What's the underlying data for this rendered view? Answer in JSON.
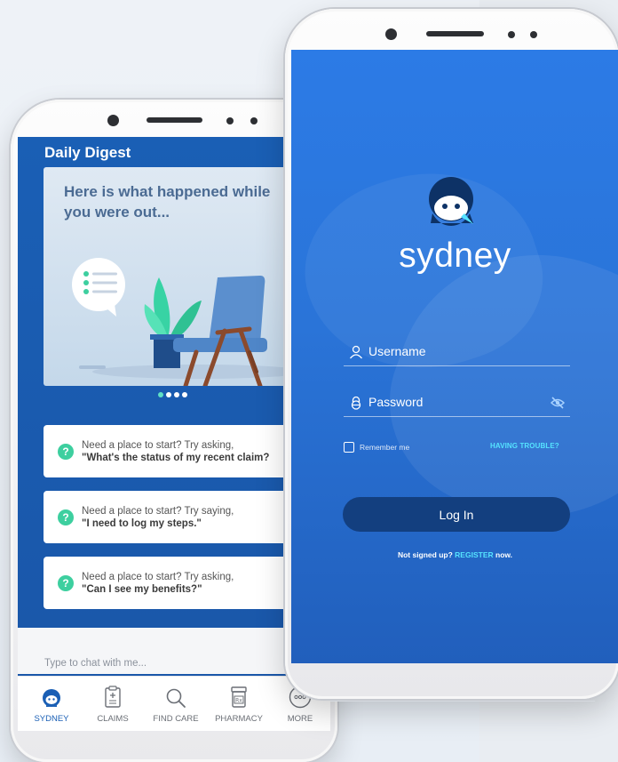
{
  "left_phone": {
    "digest_title": "Daily Digest",
    "hero_text": "Here is what happened while you were out...",
    "carousel_pages": 4,
    "carousel_active_index": 0,
    "prompts": [
      {
        "intro": "Need a place to start? Try asking,",
        "question": "\"What's the status of my recent claim?"
      },
      {
        "intro": "Need a place to start? Try saying,",
        "question": "\"I need to log my steps.\""
      },
      {
        "intro": "Need a place to start? Try asking,",
        "question": "\"Can I see my benefits?\""
      }
    ],
    "prompt_icon": "?",
    "chat_placeholder": "Type to chat with me...",
    "tabs": [
      {
        "label": "SYDNEY",
        "icon": "sydney-avatar-icon",
        "active": true
      },
      {
        "label": "CLAIMS",
        "icon": "clipboard-icon",
        "active": false
      },
      {
        "label": "FIND CARE",
        "icon": "search-icon",
        "active": false
      },
      {
        "label": "PHARMACY",
        "icon": "pill-bottle-icon",
        "active": false
      },
      {
        "label": "MORE",
        "icon": "more-icon",
        "active": false
      }
    ]
  },
  "right_phone": {
    "brand_name": "sydney",
    "username_label": "Username",
    "password_label": "Password",
    "remember_label": "Remember me",
    "trouble_link": "HAVING TROUBLE?",
    "login_button": "Log In",
    "signup_prefix": "Not signed up?",
    "signup_link": "REGISTER",
    "signup_suffix": "now."
  },
  "colors": {
    "primary_blue": "#1a5fb5",
    "login_blue": "#2c7be6",
    "button_navy": "#133f7f",
    "accent_cyan": "#55e3ff",
    "accent_green": "#3dcf9f"
  }
}
